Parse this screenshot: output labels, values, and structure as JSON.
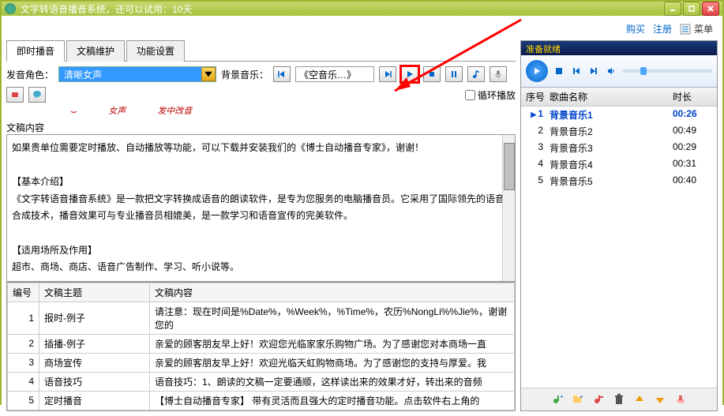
{
  "titlebar": {
    "text": "文字转语音播音系统，还可以试用：10天"
  },
  "top_links": {
    "buy": "购买",
    "register": "注册",
    "menu": "菜单"
  },
  "tabs": [
    "即时播音",
    "文稿维护",
    "功能设置"
  ],
  "voice_role": {
    "label": "发音角色：",
    "value": "清晰女声"
  },
  "voice_hints": [
    "女声",
    "发中改音"
  ],
  "bg_music": {
    "label": "背景音乐：",
    "value": "《空音乐…》"
  },
  "loop": {
    "label": "循环播放"
  },
  "content_label": "文稿内容",
  "content_text": "如果贵单位需要定时播放、自动播放等功能，可以下载并安装我们的《博士自动播音专家》，谢谢！\n\n【基本介绍】\n《文字转语音播音系统》是一款把文字转换成语音的朗读软件，是专为您服务的电脑播音员。它采用了国际领先的语音合成技术，播音效果可与专业播音员相媲美，是一款学习和语音宣传的完美软件。\n\n【适用场所及作用】\n超市、商场、商店、语音广告制作、学习、听小说等。",
  "script_table": {
    "headers": [
      "编号",
      "文稿主题",
      "文稿内容"
    ],
    "rows": [
      {
        "num": "1",
        "title": "报时-例子",
        "content": "请注意：现在时间是%Date%，%Week%，%Time%，农历%NongLi%%Jie%，谢谢您的"
      },
      {
        "num": "2",
        "title": "插播-例子",
        "content": "亲爱的顾客朋友早上好！欢迎您光临家家乐购物广场。为了感谢您对本商场一直"
      },
      {
        "num": "3",
        "title": "商场宣传",
        "content": "亲爱的顾客朋友早上好！欢迎光临天虹购物商场。为了感谢您的支持与厚爱。我"
      },
      {
        "num": "4",
        "title": "语音技巧",
        "content": "语音技巧：1、朗读的文稿一定要通顺，这样读出来的效果才好，转出来的音频"
      },
      {
        "num": "5",
        "title": "定时播音",
        "content": "【博士自动播音专家】  带有灵活而且强大的定时播音功能。点击软件右上角的"
      }
    ]
  },
  "player": {
    "status": "准备就绪",
    "headers": {
      "num": "序号",
      "name": "歌曲名称",
      "duration": "时长"
    },
    "tracks": [
      {
        "num": "1",
        "name": "背景音乐1",
        "duration": "00:26",
        "active": true
      },
      {
        "num": "2",
        "name": "背景音乐2",
        "duration": "00:49"
      },
      {
        "num": "3",
        "name": "背景音乐3",
        "duration": "00:29"
      },
      {
        "num": "4",
        "name": "背景音乐4",
        "duration": "00:31"
      },
      {
        "num": "5",
        "name": "背景音乐5",
        "duration": "00:40"
      }
    ]
  }
}
